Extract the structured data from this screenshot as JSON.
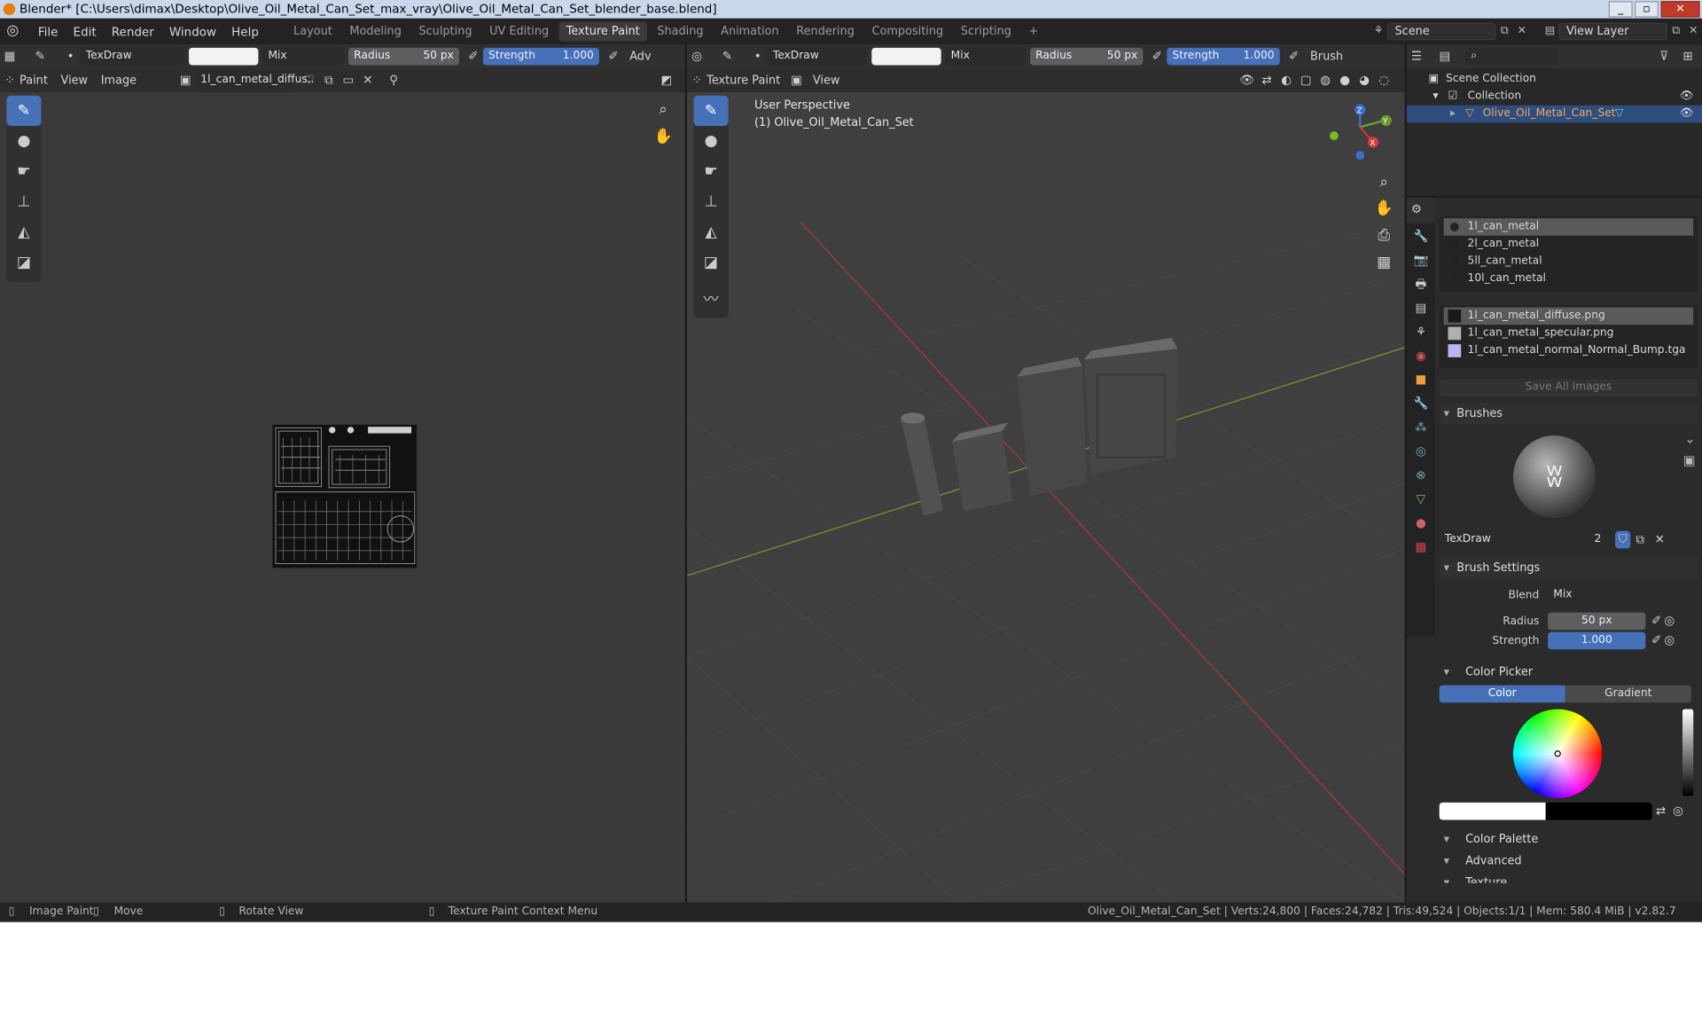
{
  "titlebar": {
    "title": "Blender* [C:\\Users\\dimax\\Desktop\\Olive_Oil_Metal_Can_Set_max_vray\\Olive_Oil_Metal_Can_Set_blender_base.blend]"
  },
  "menu": [
    "File",
    "Edit",
    "Render",
    "Window",
    "Help"
  ],
  "workspaces": [
    "Layout",
    "Modeling",
    "Sculpting",
    "UV Editing",
    "Texture Paint",
    "Shading",
    "Animation",
    "Rendering",
    "Compositing",
    "Scripting"
  ],
  "active_workspace": "Texture Paint",
  "scene": {
    "name": "Scene",
    "view_layer": "View Layer"
  },
  "image_editor": {
    "brush": "TexDraw",
    "blend": "Mix",
    "radius_label": "Radius",
    "radius_value": "50 px",
    "strength_label": "Strength",
    "strength_value": "1.000",
    "adv": "Adv",
    "mode": "Paint",
    "view": "View",
    "image": "Image",
    "image_name": "1l_can_metal_diffus.."
  },
  "viewport": {
    "brush": "TexDraw",
    "blend": "Mix",
    "radius_label": "Radius",
    "radius_value": "50 px",
    "strength_label": "Strength",
    "strength_value": "1.000",
    "brush_menu": "Brush",
    "mode": "Texture Paint",
    "view": "View",
    "overlay_line1": "User Perspective",
    "overlay_line2": "(1) Olive_Oil_Metal_Can_Set",
    "gizmo": {
      "x": "X",
      "y": "Y",
      "z": "Z"
    }
  },
  "outliner": {
    "scene_collection": "Scene Collection",
    "collection": "Collection",
    "object": "Olive_Oil_Metal_Can_Set"
  },
  "materials": [
    "1l_can_metal",
    "2l_can_metal",
    "5ll_can_metal",
    "10l_can_metal"
  ],
  "images": [
    {
      "name": "1l_can_metal_diffuse.png",
      "color": "#1a1a1a"
    },
    {
      "name": "1l_can_metal_specular.png",
      "color": "#b0b0b0"
    },
    {
      "name": "1l_can_metal_normal_Normal_Bump.tga",
      "color": "#b9b7f2"
    }
  ],
  "save_all": "Save All Images",
  "brushes": {
    "section": "Brushes",
    "brush_name": "TexDraw",
    "users": "2",
    "settings_section": "Brush Settings",
    "blend_label": "Blend",
    "blend_value": "Mix",
    "radius_label": "Radius",
    "radius_value": "50 px",
    "strength_label": "Strength",
    "strength_value": "1.000",
    "color_picker": "Color Picker",
    "tab_color": "Color",
    "tab_gradient": "Gradient",
    "color_palette": "Color Palette",
    "advanced": "Advanced",
    "texture": "Texture"
  },
  "status": {
    "image_paint": "Image Paint",
    "move": "Move",
    "rotate": "Rotate View",
    "context": "Texture Paint Context Menu",
    "stats": "Olive_Oil_Metal_Can_Set | Verts:24,800 | Faces:24,782 | Tris:49,524 | Objects:1/1 | Mem: 580.4 MiB | v2.82.7"
  },
  "colors": {
    "accent": "#4670b8",
    "selected": "#4f6fa5",
    "header": "#303030",
    "panel": "#3d3d3d",
    "viewport_bg": "#3f3f3f"
  }
}
